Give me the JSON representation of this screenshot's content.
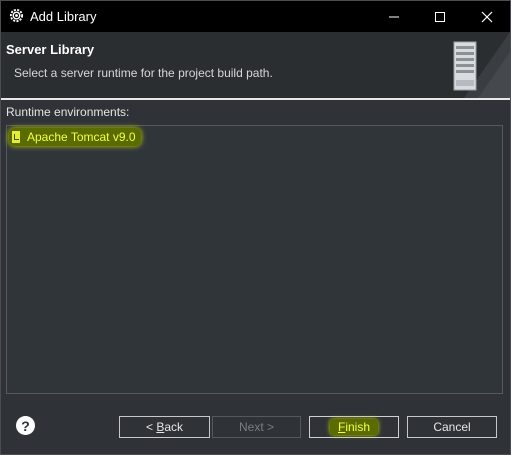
{
  "window": {
    "title": "Add Library",
    "app_icon": "eclipse-gear-icon"
  },
  "header": {
    "title": "Server Library",
    "description": "Select a server runtime for the project build path.",
    "banner_icon": "server-icon"
  },
  "runtime": {
    "label": "Runtime environments:",
    "items": [
      {
        "label": "Apache Tomcat v9.0",
        "checked": true
      }
    ]
  },
  "buttons": {
    "help": "?",
    "back_prefix": "< ",
    "back_mnemonic": "B",
    "back_rest": "ack",
    "next": "Next >",
    "finish_mnemonic": "F",
    "finish_rest": "inish",
    "cancel": "Cancel"
  },
  "colors": {
    "highlight": "#f2ff40",
    "highlight_bg": "#5a6b00",
    "background": "#2f3337"
  }
}
